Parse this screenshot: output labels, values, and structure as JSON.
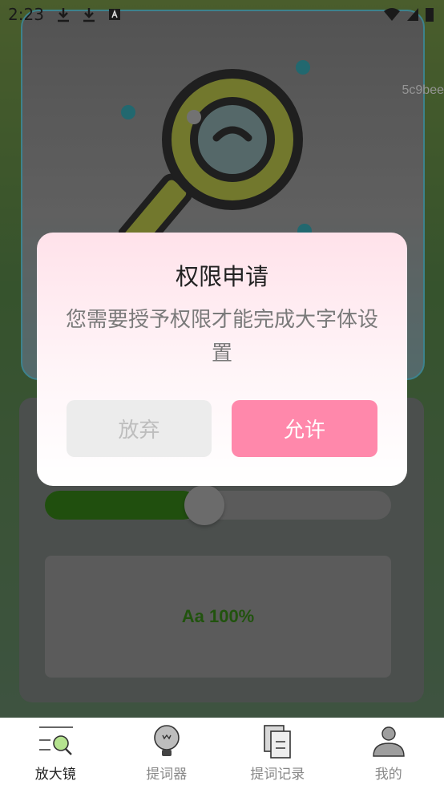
{
  "status_bar": {
    "time": "2:23"
  },
  "watermark": "5c9bee",
  "preview": {
    "text": "Aa 100%"
  },
  "slider": {
    "value_fraction": 0.42
  },
  "dialog": {
    "title": "权限申请",
    "message": "您需要授予权限才能完成大字体设置",
    "cancel_label": "放弃",
    "allow_label": "允许"
  },
  "bottom_nav": {
    "items": [
      {
        "label": "放大镜",
        "icon": "magnifier-icon",
        "active": true
      },
      {
        "label": "提词器",
        "icon": "bulb-icon",
        "active": false
      },
      {
        "label": "提词记录",
        "icon": "document-icon",
        "active": false
      },
      {
        "label": "我的",
        "icon": "person-icon",
        "active": false
      }
    ]
  },
  "colors": {
    "accent": "#ff88ab",
    "slider_fill": "#1c6400",
    "hero_border": "#49b2c4"
  }
}
